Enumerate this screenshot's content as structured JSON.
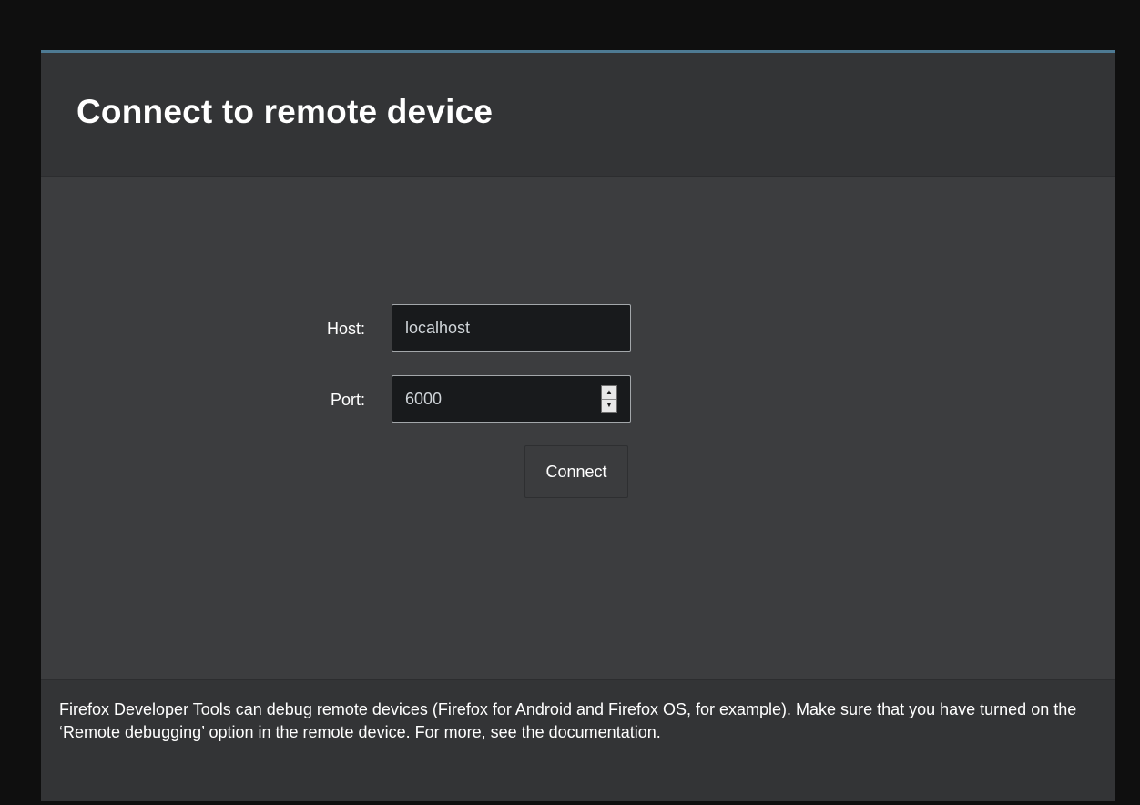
{
  "dialog": {
    "title": "Connect to remote device"
  },
  "form": {
    "host_label": "Host:",
    "host_value": "localhost",
    "port_label": "Port:",
    "port_value": "6000",
    "connect_label": "Connect"
  },
  "footer": {
    "text_before_link": "Firefox Developer Tools can debug remote devices (Firefox for Android and Firefox OS, for example). Make sure that you have turned on the ‘Remote debugging’ option in the remote device. For more, see the ",
    "link_text": "documentation",
    "text_after_link": "."
  },
  "colors": {
    "accent_border": "#4e7a93",
    "panel_background": "#3c3d3f",
    "header_background": "#333436",
    "input_background": "#181a1c"
  },
  "icons": {
    "spinner_up": "arrow-up-icon",
    "spinner_down": "arrow-down-icon"
  }
}
